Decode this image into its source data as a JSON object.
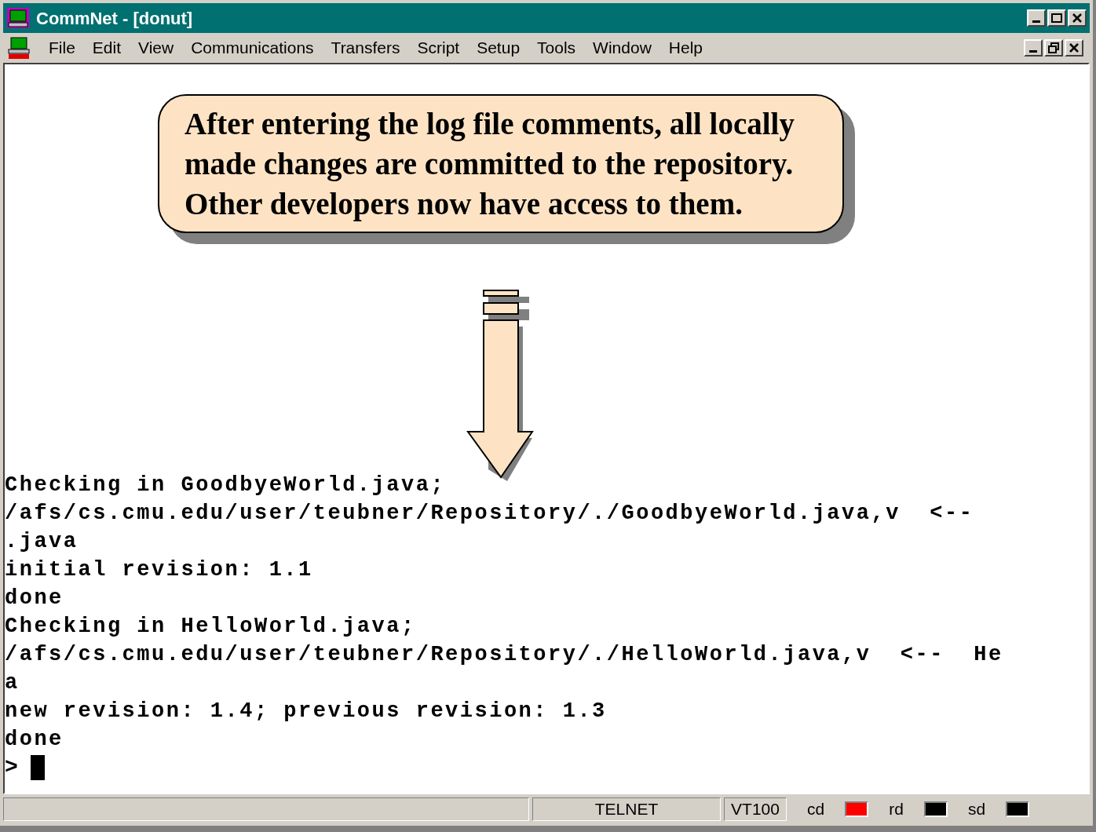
{
  "window": {
    "title": "CommNet - [donut]"
  },
  "menu": [
    "File",
    "Edit",
    "View",
    "Communications",
    "Transfers",
    "Script",
    "Setup",
    "Tools",
    "Window",
    "Help"
  ],
  "callout": {
    "text": "After entering the log file comments, all locally made changes are committed to the repository. Other developers now have access to them."
  },
  "terminal": {
    "lines": [
      "Checking in GoodbyeWorld.java;",
      "/afs/cs.cmu.edu/user/teubner/Repository/./GoodbyeWorld.java,v  <--",
      ".java",
      "initial revision: 1.1",
      "done",
      "Checking in HelloWorld.java;",
      "/afs/cs.cmu.edu/user/teubner/Repository/./HelloWorld.java,v  <--  He",
      "a",
      "new revision: 1.4; previous revision: 1.3",
      "done"
    ],
    "prompt": ">"
  },
  "status_bar": {
    "protocol": "TELNET",
    "emulation": "VT100",
    "indicators": [
      {
        "label": "cd",
        "color": "#ff0000"
      },
      {
        "label": "rd",
        "color": "#000000"
      },
      {
        "label": "sd",
        "color": "#000000"
      }
    ]
  }
}
